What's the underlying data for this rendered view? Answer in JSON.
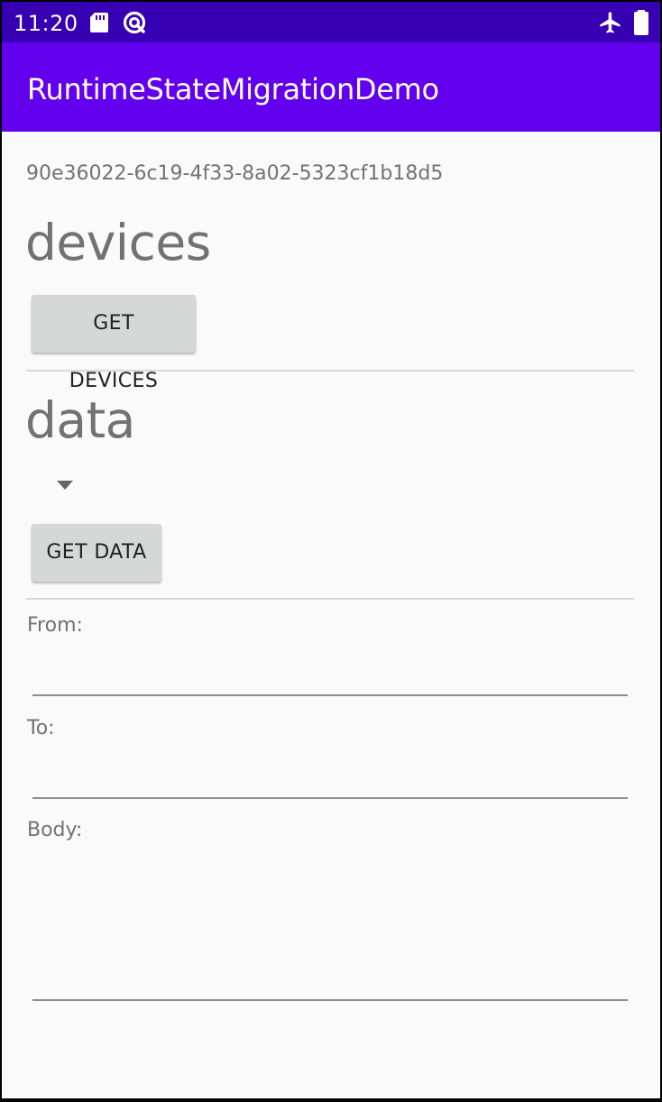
{
  "status_bar": {
    "time": "11:20",
    "icons": [
      "sd-card-icon",
      "sync-icon",
      "airplane-mode-icon",
      "battery-icon"
    ],
    "background": "#3700b3"
  },
  "app_bar": {
    "title": "RuntimeStateMigrationDemo",
    "background": "#6200ee"
  },
  "main": {
    "uuid": "90e36022-6c19-4f33-8a02-5323cf1b18d5",
    "devices_section": {
      "heading": "devices",
      "button_label": "GET DEVICES"
    },
    "data_section": {
      "heading": "data",
      "spinner_value": "",
      "button_label": "GET DATA"
    },
    "form": {
      "from_label": "From:",
      "from_value": "",
      "to_label": "To:",
      "to_value": "",
      "body_label": "Body:",
      "body_value": ""
    }
  }
}
